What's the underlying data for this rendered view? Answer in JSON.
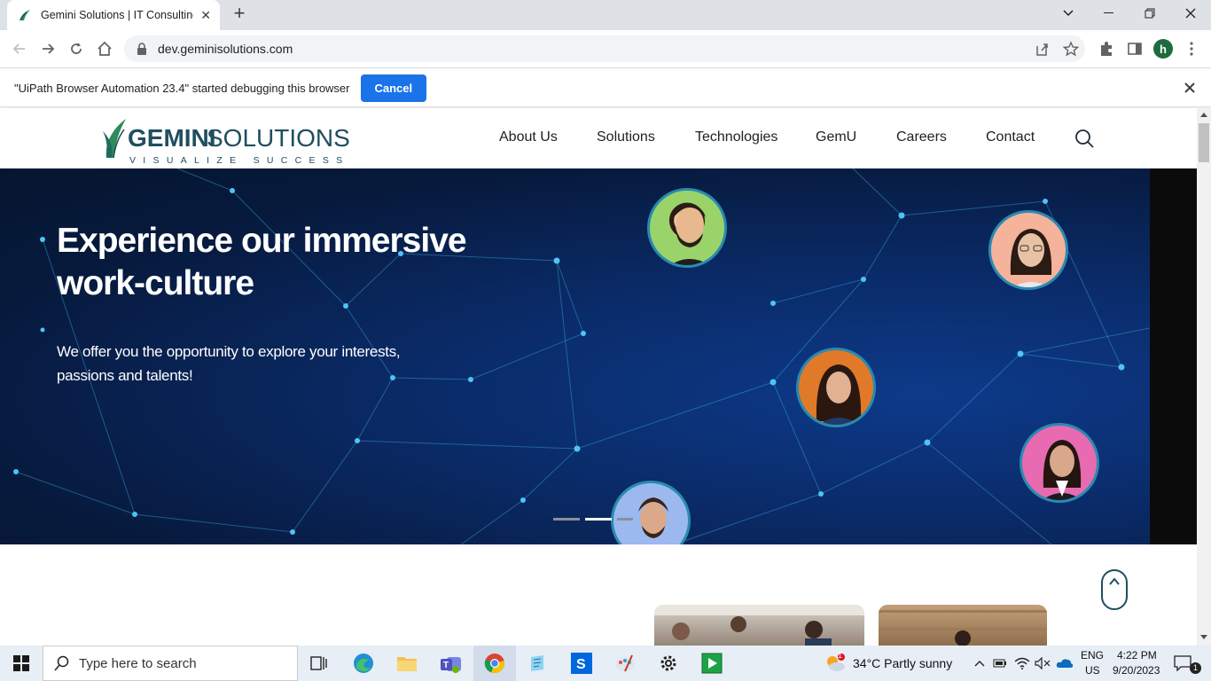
{
  "browser": {
    "tab_title": "Gemini Solutions | IT Consulting",
    "new_tab": "+",
    "url": "dev.geminisolutions.com",
    "profile_initial": "h"
  },
  "infobar": {
    "message": "\"UiPath Browser Automation 23.4\" started debugging this browser",
    "cancel_label": "Cancel"
  },
  "site": {
    "logo_bold": "GEMINI",
    "logo_light": "SOLUTIONS",
    "logo_tagline": "VISUALIZE SUCCESS",
    "nav": [
      "About Us",
      "Solutions",
      "Technologies",
      "GemU",
      "Careers",
      "Contact"
    ]
  },
  "hero": {
    "headline": "Experience our immersive work-culture",
    "subtext": "We offer you the opportunity to explore your interests, passions and talents!",
    "active_slide": 2,
    "slide_count": 3
  },
  "taskbar": {
    "search_placeholder": "Type here to search",
    "weather": "34°C  Partly sunny",
    "weather_badge": "1",
    "lang_top": "ENG",
    "lang_bottom": "US",
    "time": "4:22 PM",
    "date": "9/20/2023",
    "notification_count": "1"
  }
}
